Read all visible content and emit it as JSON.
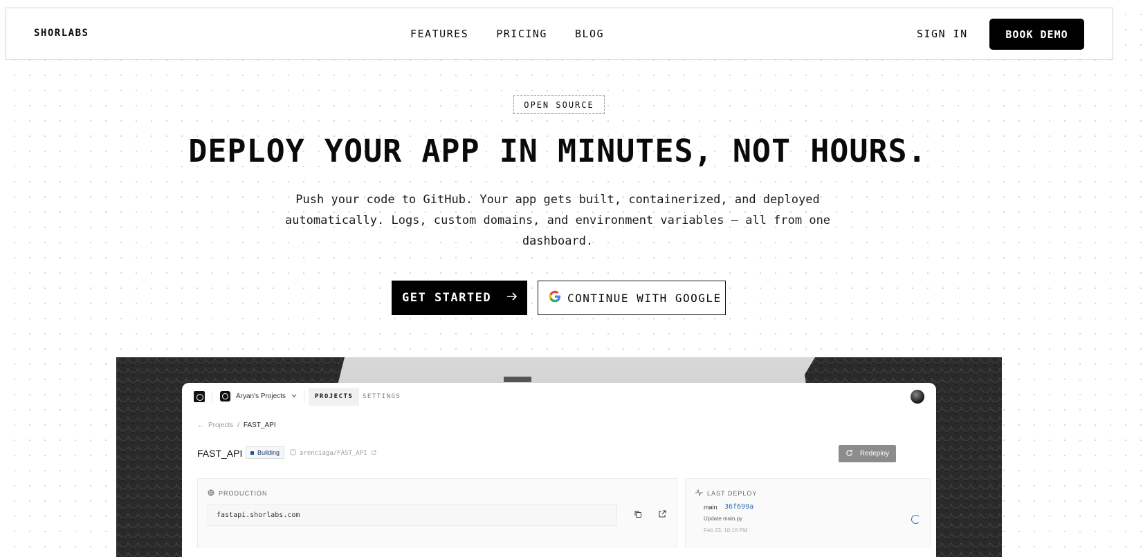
{
  "nav": {
    "brand": "SHORLABS",
    "links": [
      "FEATURES",
      "PRICING",
      "BLOG"
    ],
    "sign_in": "SIGN IN",
    "book_demo": "BOOK DEMO"
  },
  "hero": {
    "badge": "OPEN SOURCE",
    "headline": "DEPLOY YOUR APP IN MINUTES, NOT HOURS.",
    "subline_1": "Push your code to GitHub. Your app gets built, containerized, and deployed",
    "subline_2": "automatically. Logs, custom domains, and environment variables — all from one",
    "subline_3": "dashboard.",
    "cta_primary": "GET STARTED",
    "cta_google": "CONTINUE WITH GOOGLE"
  },
  "dashboard": {
    "workspace": "Aryan's Projects",
    "tabs": [
      "PROJECTS",
      "SETTINGS"
    ],
    "active_tab": "PROJECTS",
    "breadcrumb": {
      "back": "Projects",
      "current": "FAST_API"
    },
    "project_title": "FAST_API",
    "status": "Building",
    "repo": "arenciaga/FAST_API",
    "redeploy": "Redeploy",
    "production": {
      "label": "PRODUCTION",
      "url": "fastapi.shorlabs.com"
    },
    "last_deploy": {
      "label": "LAST DEPLOY",
      "branch": "main",
      "commit": "36f699a",
      "message": "Update main.py",
      "time": "Feb 23, 10:16 PM"
    }
  },
  "colors": {
    "accent": "#000000",
    "link_blue": "#2f6fb3",
    "status_blue": "#1a4fa0"
  },
  "icons": {
    "arrow": "arrow-right-icon",
    "google": "google-icon",
    "globe": "globe-icon",
    "copy": "copy-icon",
    "external": "external-link-icon",
    "activity": "activity-icon",
    "refresh": "refresh-icon"
  }
}
